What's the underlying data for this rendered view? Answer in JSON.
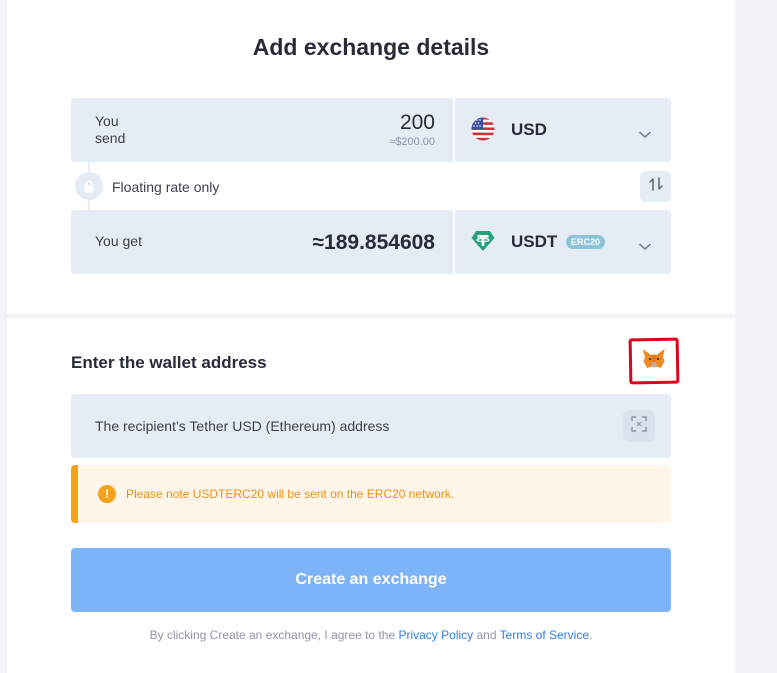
{
  "exchange": {
    "title": "Add exchange details",
    "send": {
      "label_line1": "You",
      "label_line2": "send",
      "amount": "200",
      "approx": "≈$200.00",
      "currency": "USD",
      "currency_icon": "us-flag-icon"
    },
    "rate": {
      "text": "Floating rate only"
    },
    "get": {
      "label": "You get",
      "amount": "≈189.854608",
      "currency": "USDT",
      "badge": "ERC20",
      "currency_icon": "tether-icon"
    }
  },
  "wallet": {
    "title": "Enter the wallet address",
    "placeholder": "The recipient’s Tether USD (Ethereum) address",
    "wallet_icon": "metamask-fox-icon"
  },
  "notice": {
    "text": "Please note USDTERC20 will be sent on the ERC20 network.",
    "icon_text": "!"
  },
  "actions": {
    "create_label": "Create an exchange"
  },
  "terms": {
    "prefix": "By clicking Create an exchange, I agree to the",
    "privacy": "Privacy Policy",
    "and": "and",
    "tos": "Terms of Service",
    "suffix": "."
  },
  "colors": {
    "primary_button": "#7db3f7",
    "field_bg": "#e6ecf5",
    "warning": "#f4a21b",
    "tether_green": "#26a17b",
    "badge_bg": "#8cc3d8",
    "annotation_red": "#e0001b"
  }
}
